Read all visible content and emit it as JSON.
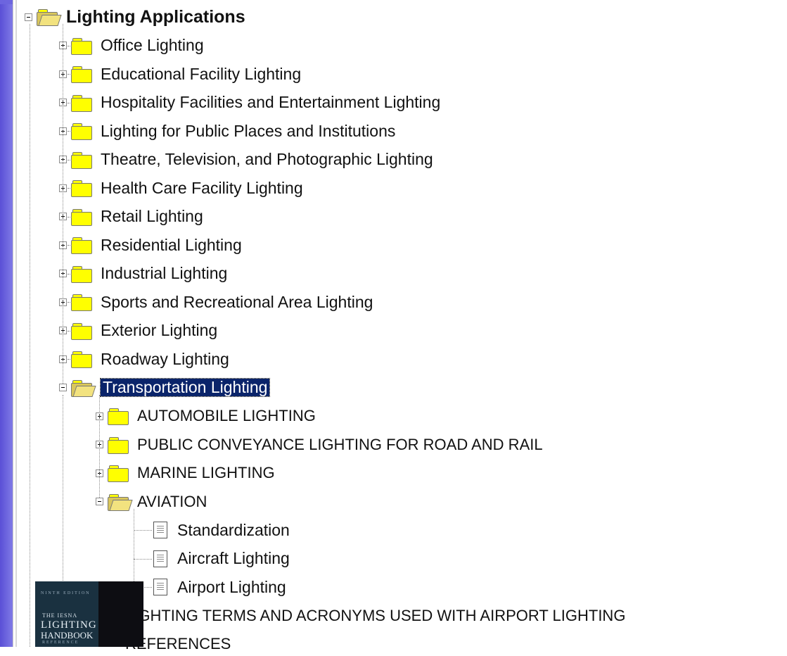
{
  "tree": {
    "root": {
      "label": "Lighting Applications"
    },
    "children": [
      "Office Lighting",
      "Educational Facility Lighting",
      "Hospitality Facilities and Entertainment Lighting",
      "Lighting for Public Places and Institutions",
      "Theatre, Television, and Photographic Lighting",
      "Health Care Facility Lighting",
      "Retail Lighting",
      "Residential Lighting",
      "Industrial Lighting",
      "Sports and Recreational Area Lighting",
      "Exterior Lighting",
      "Roadway Lighting"
    ],
    "transportation": {
      "label": "Transportation Lighting",
      "children": [
        "AUTOMOBILE LIGHTING",
        "PUBLIC CONVEYANCE LIGHTING FOR ROAD AND RAIL",
        "MARINE LIGHTING"
      ],
      "aviation": {
        "label": "AVIATION",
        "documents": [
          "Standardization",
          "Aircraft Lighting",
          "Airport Lighting"
        ]
      },
      "after_aviation": [
        "LIGHTING TERMS AND   ACRONYMS USED WITH AIRPORT LIGHTING",
        "REFERENCES"
      ]
    }
  },
  "book_cover": {
    "line1": "NINTH EDITION",
    "line2": "THE IESNA",
    "line3": "LIGHTING",
    "line4": "HANDBOOK",
    "line5": "REFERENCE"
  },
  "colors": {
    "folder": "#ffff00",
    "selection": "#0a246a",
    "frame_accent": "#5a4fd6"
  },
  "icons": {
    "folder": "folder-icon",
    "folder_open": "folder-open-icon",
    "document": "document-icon",
    "expand": "plus-box-icon",
    "collapse": "minus-box-icon"
  }
}
